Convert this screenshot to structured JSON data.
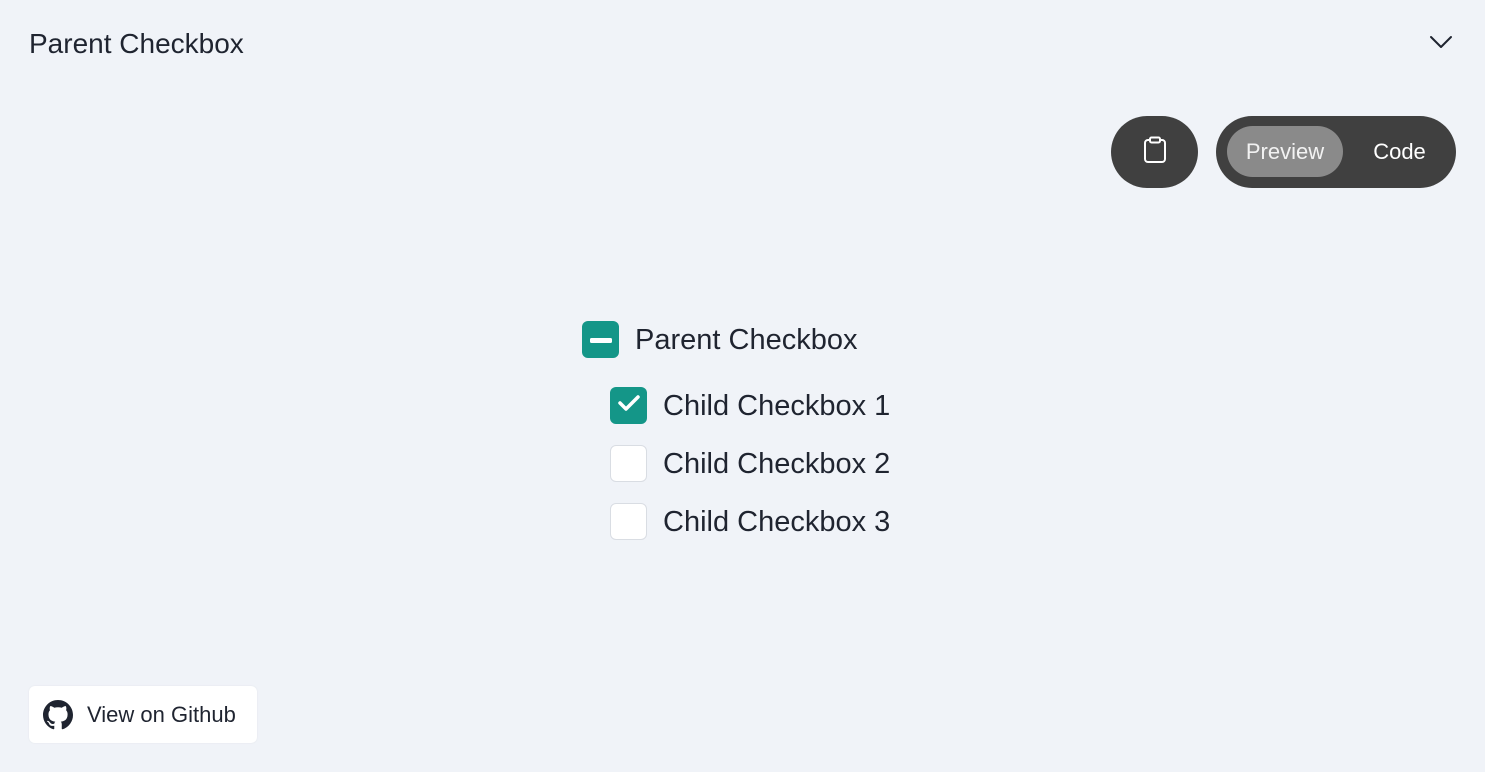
{
  "header": {
    "title": "Parent Checkbox",
    "collapse_icon": "chevron-down-icon"
  },
  "toolbar": {
    "copy_icon": "clipboard-icon",
    "preview_label": "Preview",
    "code_label": "Code",
    "active_view": "Preview"
  },
  "checkbox_group": {
    "parent": {
      "label": "Parent Checkbox",
      "state": "indeterminate"
    },
    "children": [
      {
        "label": "Child Checkbox 1",
        "checked": true
      },
      {
        "label": "Child Checkbox 2",
        "checked": false
      },
      {
        "label": "Child Checkbox 3",
        "checked": false
      }
    ]
  },
  "footer": {
    "github_label": "View on Github",
    "github_icon": "github-icon"
  },
  "colors": {
    "accent": "#149688",
    "panel_background": "#f0f3f8",
    "toolbar_dark": "#404040",
    "toggle_active": "#8a8a8a"
  }
}
